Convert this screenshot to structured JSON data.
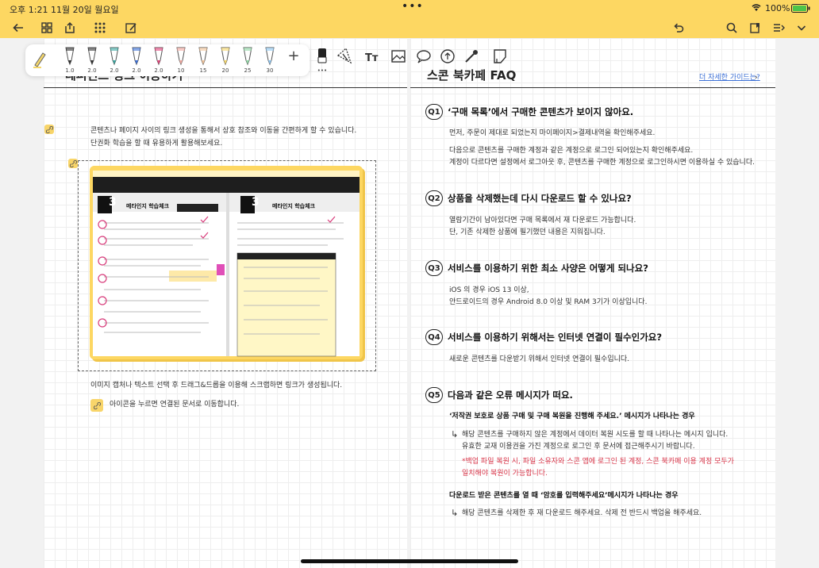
{
  "status_bar": {
    "time": "오후 1:21",
    "date": "11월 20일 월요일",
    "battery": "100%"
  },
  "toolbar": {
    "pens": [
      {
        "label": "1.0",
        "color": "#333333"
      },
      {
        "label": "2.0",
        "color": "#333333"
      },
      {
        "label": "2.0",
        "color": "#3aa6a0"
      },
      {
        "label": "2.0",
        "color": "#3b6fd6"
      },
      {
        "label": "2.0",
        "color": "#e0457b"
      },
      {
        "label": "10",
        "color": "#f2a9a0"
      },
      {
        "label": "15",
        "color": "#f2c49a"
      },
      {
        "label": "20",
        "color": "#f5d76a"
      },
      {
        "label": "25",
        "color": "#8fd6a4"
      },
      {
        "label": "30",
        "color": "#8fc6ef"
      }
    ],
    "add_label": "+",
    "text_tool_label": "Tт"
  },
  "left_page": {
    "title": "레퍼런스 링크 이용하기",
    "intro_line1": "콘텐츠나 페이지 사이의 링크 생성을 통해서 상호 참조와 이동을 간편하게 할 수 있습니다.",
    "intro_line2": "단권화 학습을 할 때 유용하게 활용해보세요.",
    "caption1": "이미지 캡처나 텍스트 선택 후 드래그&드롭을 이용해 스크랩하면 링크가 생성됩니다.",
    "caption2": "아이콘을 누르면 연결된 문서로 이동합니다.",
    "screenshot": {
      "left_header": "메타인지 학습체크",
      "right_header": "메타인지 학습체크",
      "chapter": "3"
    }
  },
  "right_page": {
    "title": "스콘 북카페 FAQ",
    "guide_link": "더 자세한 가이드는?",
    "faqs": [
      {
        "badge": "Q1",
        "question": "‘구매 목록’에서 구매한 콘텐츠가 보이지 않아요.",
        "lines": [
          "먼저, 주문이 제대로 되었는지 마이페이지>결제내역을 확인해주세요.",
          "다음으로 콘텐츠를 구매한 계정과 같은 계정으로 로그인 되어있는지 확인해주세요.",
          "계정이 다르다면 설정에서 로그아웃 후, 콘텐츠를 구매한 계정으로 로그인하시면 이용하실 수 있습니다."
        ]
      },
      {
        "badge": "Q2",
        "question": "상품을 삭제했는데 다시 다운로드 할 수 있나요?",
        "lines": [
          "열람기간이 남아있다면 구매 목록에서 재 다운로드 가능합니다.",
          "단, 기존 삭제한 상품에 필기했던 내용은 지워집니다."
        ]
      },
      {
        "badge": "Q3",
        "question": "서비스를 이용하기 위한 최소 사양은 어떻게 되나요?",
        "lines": [
          "iOS 의 경우 iOS 13 이상,",
          "안드로이드의 경우 Android 8.0 이상 및 RAM 3기가 이상입니다."
        ]
      },
      {
        "badge": "Q4",
        "question": "서비스를 이용하기 위해서는 인터넷 연결이 필수인가요?",
        "lines": [
          "새로운 콘텐츠를 다운받기 위해서 인터넷 연결이 필수입니다."
        ]
      },
      {
        "badge": "Q5",
        "question": "다음과 같은 오류 메시지가 떠요.",
        "lines": []
      }
    ],
    "q5": {
      "case1_title": "‘저작권 보호로 상품 구매 및 구매 복원을 진행해 주세요.’ 메시지가 나타나는 경우",
      "case1_line1": "해당 콘텐츠를 구매하지 않은 계정에서 데이터 복원 시도를 할 때 나타나는 메시지 입니다.",
      "case1_line2": "유효한 교재 이용권을 가진 계정으로 로그인 후 문서에 접근해주시기 바랍니다.",
      "case1_note1": "*백업 파일 복원 시, 파일 소유자와 스콘 앱에 로그인 된 계정, 스콘 북카페 이용 계정 모두가",
      "case1_note2": "일치해야 복원이 가능합니다.",
      "case2_title": "다운로드 받은 콘텐츠를 열 때 ‘암호를 입력해주세요’메시지가 나타나는 경우",
      "case2_line1": "해당 콘텐츠를 삭제한 후 재 다운로드 해주세요. 삭제 전 반드시 백업을 해주세요."
    }
  }
}
